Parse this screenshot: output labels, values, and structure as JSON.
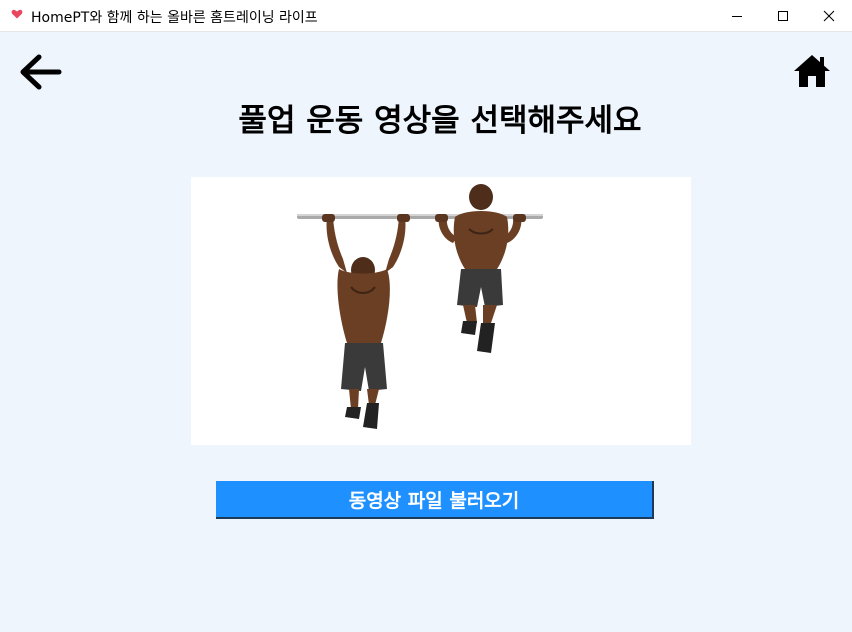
{
  "window": {
    "title": "HomePT와 함께 하는 올바른 홈트레이닝 라이프",
    "app_icon": "heart-icon",
    "minimize_icon": "minimize-icon",
    "maximize_icon": "maximize-icon",
    "close_icon": "close-icon"
  },
  "nav": {
    "back_icon": "arrow-left-icon",
    "home_icon": "home-icon"
  },
  "main": {
    "heading": "풀업 운동 영상을 선택해주세요",
    "image": "pull-up-exercise-illustration",
    "load_button_label": "동영상 파일 불러오기"
  },
  "colors": {
    "background": "#eef5fd",
    "button": "#1e90ff",
    "heart": "#e8475f"
  }
}
